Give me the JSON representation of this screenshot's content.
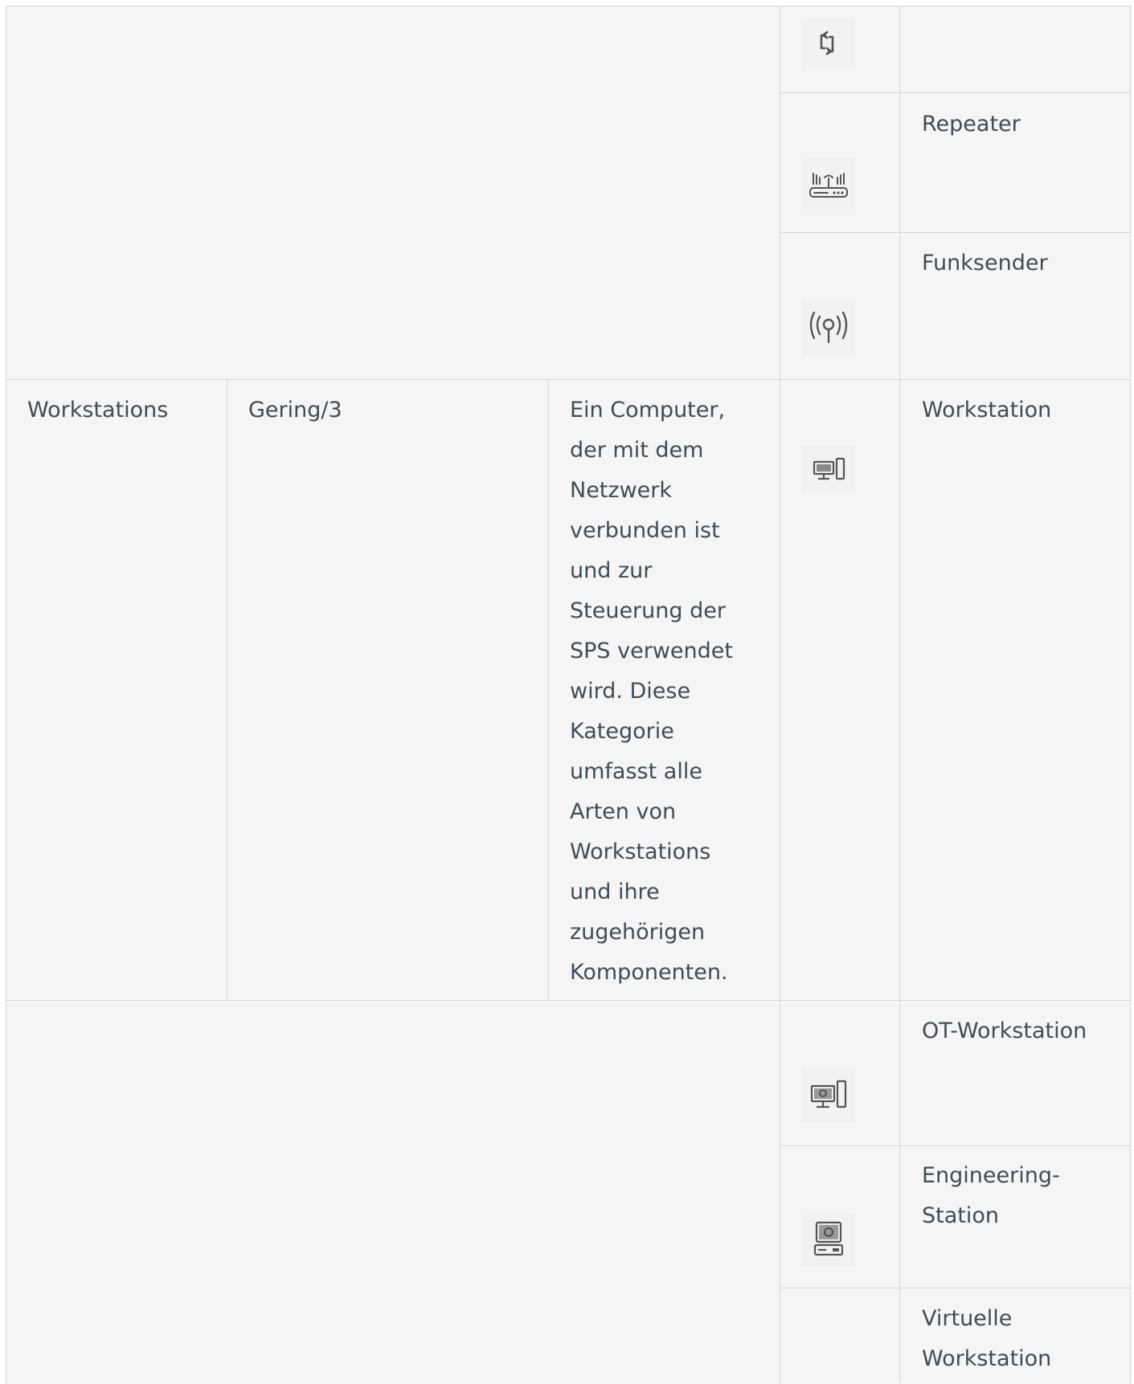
{
  "table": {
    "top_rows": [
      {
        "device_type": ""
      },
      {
        "device_type": "Repeater"
      },
      {
        "device_type": "Funksender"
      }
    ],
    "workstations_row": {
      "category": "Workstations",
      "level": "Gering/3",
      "description_lines": [
        "Ein Computer,",
        "der mit dem",
        "Netzwerk",
        "verbunden ist",
        "und zur",
        "Steuerung der",
        "SPS verwendet",
        "wird. Diese",
        "Kategorie",
        "umfasst alle",
        "Arten von",
        "Workstations",
        "und ihre",
        "zugehörigen",
        "Komponenten."
      ],
      "device_type": "Workstation"
    },
    "bottom_rows": [
      {
        "device_type_lines": [
          "OT-Workstation"
        ]
      },
      {
        "device_type_lines": [
          "Engineering-",
          "Station"
        ]
      },
      {
        "device_type_lines": [
          "Virtuelle",
          "Workstation"
        ]
      }
    ],
    "icons": [
      "repeat-icon",
      "repeater-router-icon",
      "radio-transmitter-icon",
      "workstation-icon",
      "ot-workstation-icon",
      "engineering-station-icon"
    ]
  }
}
